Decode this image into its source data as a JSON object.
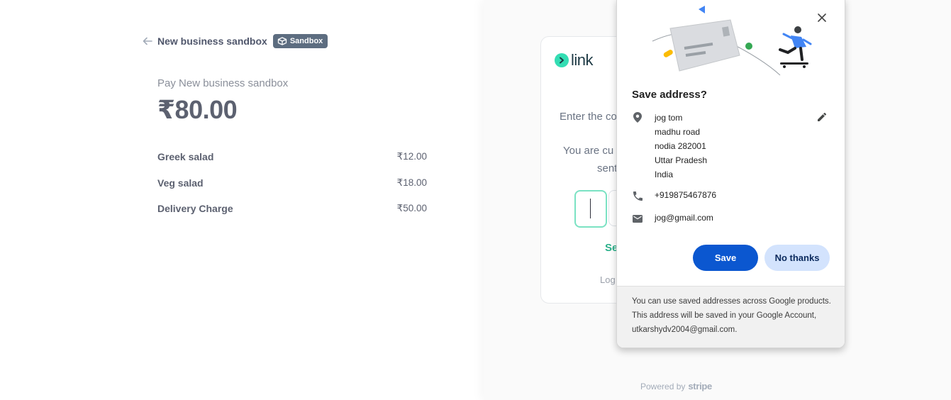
{
  "checkout": {
    "merchant_name": "New business sandbox",
    "badge_label": "Sandbox",
    "pay_label": "Pay New business sandbox",
    "total": "₹80.00",
    "items": [
      {
        "name": "Greek salad",
        "price": "₹12.00"
      },
      {
        "name": "Veg salad",
        "price": "₹18.00"
      },
      {
        "name": "Delivery Charge",
        "price": "₹50.00"
      }
    ]
  },
  "link_panel": {
    "brand": "link",
    "enter_code_text": "Enter the co",
    "you_are_text": "You are cu",
    "sent_text": "sent",
    "send_link_text": "Se",
    "logout_text": "Log",
    "powered_by": "Powered by",
    "powered_brand": "stripe"
  },
  "save_address_popup": {
    "title": "Save address?",
    "address_lines": [
      "jog tom",
      "madhu road",
      "nodia 282001",
      "Uttar Pradesh",
      "India"
    ],
    "phone": "+919875467876",
    "email": "jog@gmail.com",
    "save_label": "Save",
    "no_thanks_label": "No thanks",
    "footer_text": "You can use saved addresses across Google products. This address will be saved in your Google Account, utkarshydv2004@gmail.com.",
    "icons": [
      "close-icon",
      "location-pin-icon",
      "edit-pencil-icon",
      "phone-icon",
      "mail-icon"
    ]
  },
  "colors": {
    "save_button": "#0b57d0",
    "no_thanks_button": "#d3e3fd",
    "link_green": "#33ddb3",
    "sandbox_badge": "#5d6d80"
  }
}
